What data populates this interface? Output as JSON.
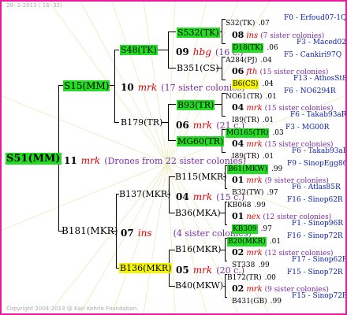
{
  "header": "28- 2-2013 ( 16: 32)",
  "footer": "Copyright 2004-2013 @ Karl Kehrle Foundation.",
  "root": {
    "label": "S51(MM)",
    "num": "11",
    "mrk": "mrk",
    "sis": "(Drones from 22 sister colonies)"
  },
  "mother": {
    "label": "S15(MM)",
    "num": "10",
    "mrk": "mrk",
    "sis": "(17 sister colonies)"
  },
  "father": {
    "label": "B181(MKR)",
    "num": "07",
    "mrk": "ins",
    "sis": "(4 sister colonies)"
  },
  "gen3": {
    "s48": {
      "label": "S48(TK)"
    },
    "b179": {
      "label": "B179(TR)",
      "num": "06",
      "mrk": "mrk",
      "sis": "(21 c.)"
    },
    "b137": {
      "label": "B137(MKR)",
      "num": "04",
      "mrk": "mrk",
      "sis": "(15 c.)"
    },
    "b136": {
      "label": "B136(MKR)",
      "num": "05",
      "mrk": "mrk",
      "sis": "(20 c.)"
    }
  },
  "gen4": {
    "s532": {
      "label": "S532(TK)"
    },
    "b351": {
      "label": "B351(CS)"
    },
    "s48_num": "09",
    "s48_mrk": "hbg",
    "s48_sis": "(16 c.)",
    "b93": {
      "label": "B93(TR)"
    },
    "mg60": {
      "label": "MG60(TR)"
    },
    "b115": {
      "label": "B115(MKR)"
    },
    "b36": {
      "label": "B36(MKA)"
    },
    "b16": {
      "label": "B16(MKR)"
    },
    "b40": {
      "label": "B40(MKW)"
    }
  },
  "rows": [
    {
      "label": "S32(TK)",
      "val": ".07",
      "code": "F0 - Erfoud07-1Q"
    },
    {
      "num": "08",
      "mrk": "ins",
      "sis": "(7 sister colonies)"
    },
    {
      "label": "D18(TK)",
      "val": ".06",
      "code": "F3 - Maced02Q",
      "hl": "green"
    },
    {
      "label": "A284(PJ)",
      "val": ".04",
      "code": "F5 - Cankiri97Q"
    },
    {
      "num": "06",
      "mrk": "fth",
      "sis": "(15 sister colonies)"
    },
    {
      "label": "B6(CS)",
      "val": ".04",
      "code": "F13 - AthosSt80R",
      "hl": "yellow"
    },
    {
      "label": "NO61(TR)",
      "val": ".01",
      "code": "F6 - NO6294R"
    },
    {
      "num": "04",
      "mrk": "mrk",
      "sis": "(15 sister colonies)"
    },
    {
      "label": "I89(TR)",
      "val": ".01",
      "code": "F6 - Takab93aR"
    },
    {
      "label": "MG165(TR)",
      "val": ".03",
      "code": "F3 - MG00R",
      "hl": "green"
    },
    {
      "num": "04",
      "mrk": "mrk",
      "sis": "(15 sister colonies)"
    },
    {
      "label": "I89(TR)",
      "val": ".01",
      "code": "F6 - Takab93aR"
    },
    {
      "label": "B61(MKW)",
      "val": ".99",
      "code": "F9 - SinopEgg86R",
      "hl": "green"
    },
    {
      "num": "01",
      "mrk": "mrk",
      "sis": "(9 sister colonies)"
    },
    {
      "label": "B32(TW)",
      "val": ".97",
      "code": "F6 - Atlas85R"
    },
    {
      "label": "KB068",
      "val": ".99",
      "code": "F16 - Sinop62R"
    },
    {
      "num": "01",
      "mrk": "nex",
      "sis": "(12 sister colonies)"
    },
    {
      "label": "KB309",
      "val": ".97",
      "code": "F1 - Sinop96R",
      "hl": "green"
    },
    {
      "label": "B20(MKR)",
      "val": ".01",
      "code": "F16 - Sinop72R",
      "hl": "green"
    },
    {
      "num": "02",
      "mrk": "mrk",
      "sis": "(12 sister colonies)"
    },
    {
      "label": "ST338",
      "val": ".99",
      "code": "F17 - Sinop62R"
    },
    {
      "label": "B172(TR)",
      "val": ".00",
      "code": "F15 - Sinop72R"
    },
    {
      "num": "02",
      "mrk": "mrk",
      "sis": "(9 sister colonies)"
    },
    {
      "label": "B431(GB)",
      "val": ".99",
      "code": "F15 - Sinop72R"
    }
  ]
}
